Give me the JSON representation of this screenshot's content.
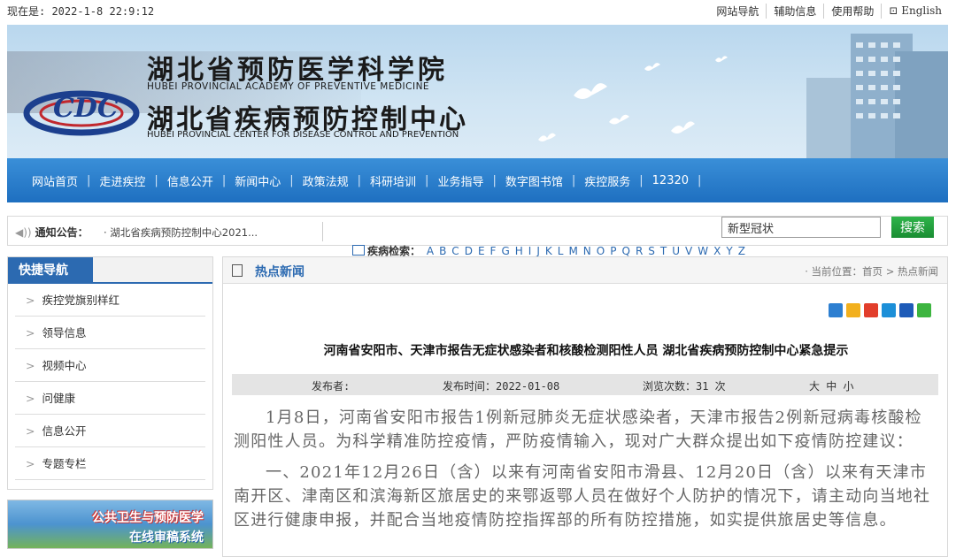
{
  "topbar": {
    "datetime": "现在是: 2022-1-8 22:9:12",
    "links": [
      "网站导航",
      "辅助信息",
      "使用帮助"
    ],
    "english": "English"
  },
  "banner": {
    "name_cn_1": "湖北省预防医学科学院",
    "name_en_1": "HUBEI PROVINCIAL ACADEMY OF PREVENTIVE MEDICINE",
    "name_cn_2": "湖北省疾病预防控制中心",
    "name_en_2": "HUBEI PROVINCIAL CENTER FOR DISEASE CONTROL AND PREVENTION",
    "logo_text": "CDC"
  },
  "nav": [
    "网站首页",
    "走进疾控",
    "信息公开",
    "新闻中心",
    "政策法规",
    "科研培训",
    "业务指导",
    "数字图书馆",
    "疾控服务",
    "12320"
  ],
  "notice": {
    "label": "通知公告：",
    "item": "· 湖北省疾病预防控制中心2021..."
  },
  "search": {
    "value": "新型冠状",
    "button": "搜索"
  },
  "disease_search": {
    "label": "疾病检索：",
    "letters": [
      "A",
      "B",
      "C",
      "D",
      "E",
      "F",
      "G",
      "H",
      "I",
      "J",
      "K",
      "L",
      "M",
      "N",
      "O",
      "P",
      "Q",
      "R",
      "S",
      "T",
      "U",
      "V",
      "W",
      "X",
      "Y",
      "Z"
    ]
  },
  "quick_nav": {
    "title": "快捷导航",
    "items": [
      "疾控党旗别样红",
      "领导信息",
      "视频中心",
      "问健康",
      "信息公开",
      "专题专栏"
    ]
  },
  "side_banner": {
    "line1": "公共卫生与预防医学",
    "line2": "在线审稿系统"
  },
  "main": {
    "section_title": "热点新闻",
    "breadcrumb": "· 当前位置：首页 > 热点新闻",
    "article_title": "河南省安阳市、天津市报告无症状感染者和核酸检测阳性人员 湖北省疾病预防控制中心紧急提示",
    "meta": {
      "publisher": "发布者:",
      "date": "发布时间：2022-01-08",
      "views": "浏览次数：31 次",
      "font_size": "大 中 小"
    },
    "paragraphs": [
      "1月8日，河南省安阳市报告1例新冠肺炎无症状感染者，天津市报告2例新冠病毒核酸检测阳性人员。为科学精准防控疫情，严防疫情输入，现对广大群众提出如下疫情防控建议：",
      "一、2021年12月26日（含）以来有河南省安阳市滑县、12月20日（含）以来有天津市南开区、津南区和滨海新区旅居史的来鄂返鄂人员在做好个人防护的情况下，请主动向当地社区进行健康申报，并配合当地疫情防控指挥部的所有防控措施，如实提供旅居史等信息。"
    ]
  },
  "share_icons": [
    {
      "name": "share-plus-icon",
      "color": "#2d7fd1"
    },
    {
      "name": "share-qzone-icon",
      "color": "#f2b01e"
    },
    {
      "name": "share-weibo-icon",
      "color": "#e23e2b"
    },
    {
      "name": "share-tqq-icon",
      "color": "#1c8fd8"
    },
    {
      "name": "share-renren-icon",
      "color": "#1e5bb8"
    },
    {
      "name": "share-wechat-icon",
      "color": "#3db540"
    }
  ]
}
